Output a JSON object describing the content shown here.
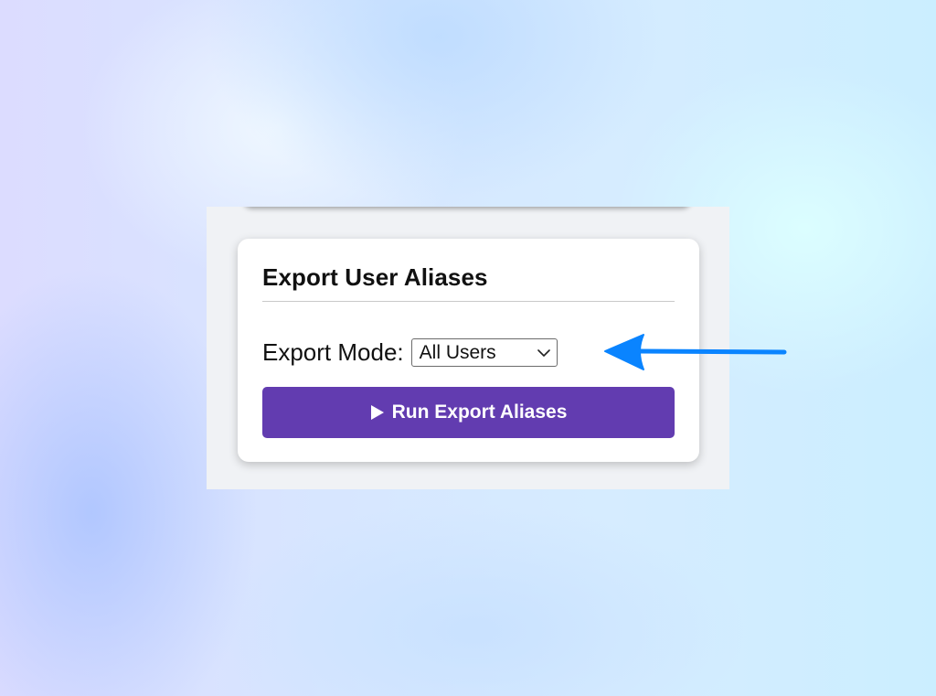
{
  "card": {
    "title": "Export User Aliases",
    "export_mode_label": "Export Mode:",
    "export_mode_value": "All Users",
    "run_button_label": "Run Export Aliases"
  },
  "icons": {
    "run_button_icon": "play-icon",
    "select_icon": "chevron-down-icon",
    "callout_arrow": "arrow-left-icon"
  },
  "colors": {
    "button_bg": "#623cb0",
    "arrow": "#0a84ff"
  }
}
